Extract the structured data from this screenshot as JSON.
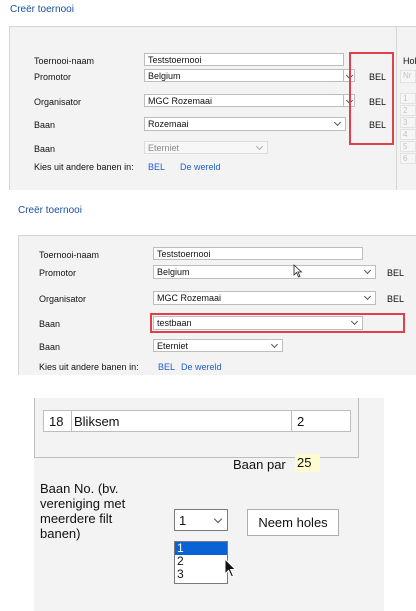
{
  "shot1": {
    "window_title": "Creër toernooi",
    "labels": {
      "name": "Toernooi-naam",
      "promoter": "Promotor",
      "organizer": "Organisator",
      "course": "Baan",
      "course2": "Baan",
      "choose_other": "Kies uit andere banen in:"
    },
    "values": {
      "name": "Teststoernooi",
      "promoter": "Belgium",
      "organizer": "MGC Rozemaai",
      "course": "Rozemaai",
      "course2": "Eterniet"
    },
    "country_codes": [
      "BEL",
      "BEL",
      "BEL"
    ],
    "links": {
      "bel": "BEL",
      "world": "De wereld"
    },
    "holes_header": "Hol",
    "holes_first_cell": "Nr",
    "holes_rows": [
      "1",
      "2",
      "3",
      "4",
      "5",
      "6"
    ]
  },
  "shot2": {
    "window_title": "Creër toernooi",
    "labels": {
      "name": "Toernooi-naam",
      "promoter": "Promotor",
      "organizer": "Organisator",
      "course": "Baan",
      "course2": "Baan",
      "choose_other": "Kies uit andere banen in:"
    },
    "values": {
      "name": "Teststoernooi",
      "promoter": "Belgium",
      "organizer": "MGC Rozemaai",
      "course": "testbaan",
      "course2": "Eterniet"
    },
    "country_codes": [
      "BEL",
      "BEL"
    ],
    "links": {
      "bel": "BEL",
      "world": "De wereld"
    }
  },
  "shot3": {
    "hole_row": {
      "number": "18",
      "name": "Bliksem",
      "par": "2"
    },
    "course_par_label": "Baan par",
    "course_par_value": "25",
    "course_no_label": [
      "Baan No. (bv.",
      "vereniging met",
      "meerdere filt",
      "banen)"
    ],
    "course_no_selected": "1",
    "course_no_options": [
      "1",
      "2",
      "3"
    ],
    "take_holes_button": "Neem holes"
  },
  "colors": {
    "highlight": "#e0404a",
    "link": "#1f5fd0",
    "par_bg": "#fffbd0",
    "list_selected": "#0a63d4"
  }
}
